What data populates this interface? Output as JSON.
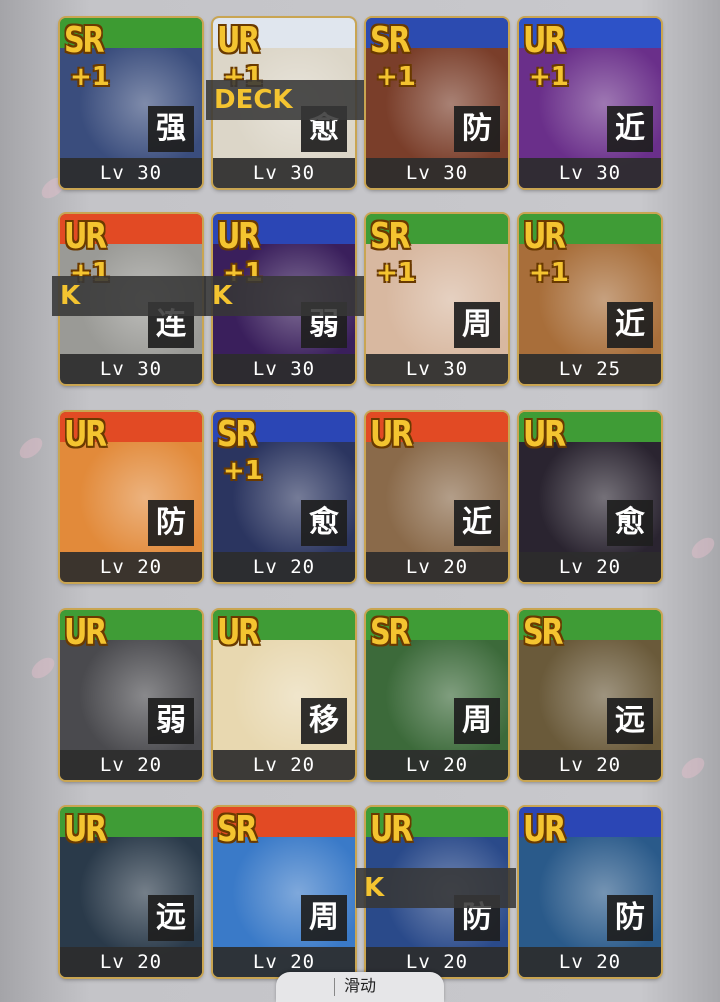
{
  "cards": [
    {
      "rarity": "SR",
      "plus": "+1",
      "role": "强",
      "level": "Lv 30",
      "header": "#3d9b32",
      "art": "#3a4d7d"
    },
    {
      "rarity": "UR",
      "plus": "+1",
      "role": "愈",
      "level": "Lv 30",
      "header": "#e0e6ee",
      "art": "#dcd6c8"
    },
    {
      "rarity": "SR",
      "plus": "+1",
      "role": "防",
      "level": "Lv 30",
      "header": "#2c4bb0",
      "art": "#7a3e2a"
    },
    {
      "rarity": "UR",
      "plus": "+1",
      "role": "近",
      "level": "Lv 30",
      "header": "#2d52c7",
      "art": "#6a2f8a"
    },
    {
      "rarity": "UR",
      "plus": "+1",
      "role": "连",
      "level": "Lv 30",
      "header": "#e24a24",
      "art": "#9a9a96"
    },
    {
      "rarity": "UR",
      "plus": "+1",
      "role": "弱",
      "level": "Lv 30",
      "header": "#2b46b5",
      "art": "#3a1f5c"
    },
    {
      "rarity": "SR",
      "plus": "+1",
      "role": "周",
      "level": "Lv 30",
      "header": "#3f9c36",
      "art": "#d8b8a0"
    },
    {
      "rarity": "UR",
      "plus": "+1",
      "role": "近",
      "level": "Lv 25",
      "header": "#3f9c36",
      "art": "#a86e3a"
    },
    {
      "rarity": "UR",
      "plus": "",
      "role": "防",
      "level": "Lv 20",
      "header": "#e24a24",
      "art": "#e28a3a"
    },
    {
      "rarity": "SR",
      "plus": "+1",
      "role": "愈",
      "level": "Lv 20",
      "header": "#2b46b5",
      "art": "#2b3560"
    },
    {
      "rarity": "UR",
      "plus": "",
      "role": "近",
      "level": "Lv 20",
      "header": "#e24a24",
      "art": "#8a6a4a"
    },
    {
      "rarity": "UR",
      "plus": "",
      "role": "愈",
      "level": "Lv 20",
      "header": "#3f9c36",
      "art": "#2a2430"
    },
    {
      "rarity": "UR",
      "plus": "",
      "role": "弱",
      "level": "Lv 20",
      "header": "#3f9c36",
      "art": "#4a4a4e"
    },
    {
      "rarity": "UR",
      "plus": "",
      "role": "移",
      "level": "Lv 20",
      "header": "#3f9c36",
      "art": "#e8d8b0"
    },
    {
      "rarity": "SR",
      "plus": "",
      "role": "周",
      "level": "Lv 20",
      "header": "#3f9c36",
      "art": "#3c6a3a"
    },
    {
      "rarity": "SR",
      "plus": "",
      "role": "远",
      "level": "Lv 20",
      "header": "#3f9c36",
      "art": "#6a5a3a"
    },
    {
      "rarity": "UR",
      "plus": "",
      "role": "远",
      "level": "Lv 20",
      "header": "#3f9c36",
      "art": "#2a3a4a"
    },
    {
      "rarity": "SR",
      "plus": "",
      "role": "周",
      "level": "Lv 20",
      "header": "#e24a24",
      "art": "#3a7ac8"
    },
    {
      "rarity": "UR",
      "plus": "",
      "role": "防",
      "level": "Lv 20",
      "header": "#3f9c36",
      "art": "#2a4a8a"
    },
    {
      "rarity": "UR",
      "plus": "",
      "role": "防",
      "level": "Lv 20",
      "header": "#2b46b5",
      "art": "#2a5a8a"
    }
  ],
  "deck_labels": {
    "full": "DECK",
    "cut_left": "K",
    "cut_mid": "K",
    "cut_bottom": "K"
  },
  "scroll": {
    "label": "滑动"
  }
}
